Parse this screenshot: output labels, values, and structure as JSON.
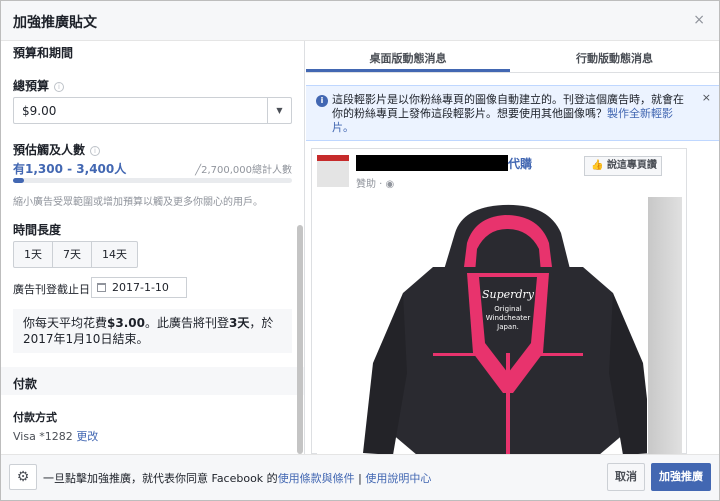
{
  "dialog": {
    "title": "加強推廣貼文",
    "close_glyph": "×"
  },
  "left": {
    "budget_section_title": "預算和期間",
    "total_budget_label": "總預算",
    "budget_value": "$9.00",
    "reach_label": "預估觸及人數",
    "reach_range": "有1,300 - 3,400人",
    "reach_total": "╱2,700,000總計人數",
    "reach_fraction": 0.04,
    "reach_hint": "縮小廣告受眾範圍或增加預算以觸及更多你關心的用戶。",
    "duration_label": "時間長度",
    "duration_options": [
      "1天",
      "7天",
      "14天"
    ],
    "end_date_label": "廣告刊登截止日",
    "end_date_value": "2017-1-10",
    "summary_prefix": "你每天平均花費",
    "summary_amount": "$3.00",
    "summary_mid": "。此廣告將刊登",
    "summary_days": "3天",
    "summary_suffix": "，於2017年1月10日結束。",
    "payment_section_title": "付款",
    "payment_method_label": "付款方式",
    "payment_card": "Visa *1282",
    "payment_edit": "更改"
  },
  "right": {
    "tabs": [
      "桌面版動態消息",
      "行動版動態消息"
    ],
    "notice_text": "這段輕影片是以你粉絲專頁的圖像自動建立的。刊登這個廣告時，就會在你的粉絲專頁上發佈這段輕影片。想要使用其他圖像嗎？",
    "notice_link": "製作全新輕影片。",
    "notice_close": "×",
    "post_name_tail": "代購",
    "post_sponsored": "贊助 · ",
    "like_page_label": "說這專頁讚",
    "jacket_brand": "Superdry",
    "jacket_line1": "Original",
    "jacket_line2": "Windcheater",
    "jacket_line3": "Japan."
  },
  "footer": {
    "gear_glyph": "⚙",
    "consent_prefix": "一旦點擊加強推廣，就代表你同意 Facebook 的",
    "terms_link": "使用條款與條件",
    "separator": " | ",
    "help_link": "使用說明中心",
    "cancel_label": "取消",
    "boost_label": "加強推廣"
  },
  "colors": {
    "accent": "#4267b2",
    "jacket_body": "#2a2a30",
    "jacket_lining": "#e8336d"
  }
}
